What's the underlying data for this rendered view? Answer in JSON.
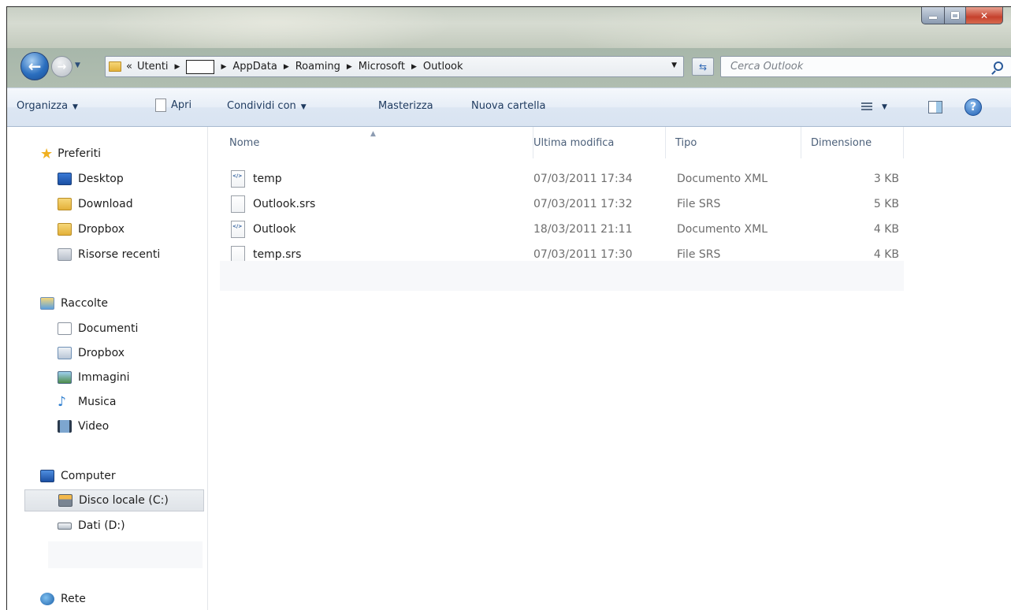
{
  "breadcrumb": {
    "overflow": "«",
    "items": [
      "Utenti",
      "AppData",
      "Roaming",
      "Microsoft",
      "Outlook"
    ]
  },
  "search": {
    "placeholder": "Cerca Outlook"
  },
  "toolbar": {
    "organize": "Organizza",
    "open": "Apri",
    "share": "Condividi con",
    "burn": "Masterizza",
    "new_folder": "Nuova cartella"
  },
  "sidebar": {
    "favorites": {
      "label": "Preferiti",
      "items": [
        "Desktop",
        "Download",
        "Dropbox",
        "Risorse recenti"
      ]
    },
    "libraries": {
      "label": "Raccolte",
      "items": [
        "Documenti",
        "Dropbox",
        "Immagini",
        "Musica",
        "Video"
      ]
    },
    "computer": {
      "label": "Computer",
      "items": [
        "Disco locale (C:)",
        "Dati (D:)"
      ],
      "selected": "Disco locale (C:)"
    },
    "network": {
      "label": "Rete"
    }
  },
  "columns": {
    "name": "Nome",
    "modified": "Ultima modifica",
    "type": "Tipo",
    "size": "Dimensione"
  },
  "files": [
    {
      "name": "temp",
      "modified": "07/03/2011 17:34",
      "type": "Documento XML",
      "size": "3 KB",
      "icon": "xml-file-icon"
    },
    {
      "name": "Outlook.srs",
      "modified": "07/03/2011 17:32",
      "type": "File SRS",
      "size": "5 KB",
      "icon": "blank-file-icon"
    },
    {
      "name": "Outlook",
      "modified": "18/03/2011 21:11",
      "type": "Documento XML",
      "size": "4 KB",
      "icon": "xml-file-icon"
    },
    {
      "name": "temp.srs",
      "modified": "07/03/2011 17:30",
      "type": "File SRS",
      "size": "4 KB",
      "icon": "blank-file-icon"
    }
  ],
  "colors": {
    "accent": "#2b6fbf",
    "close": "#c6412d",
    "toolbar_text": "#1e3a5f",
    "header_text": "#4c607a"
  }
}
